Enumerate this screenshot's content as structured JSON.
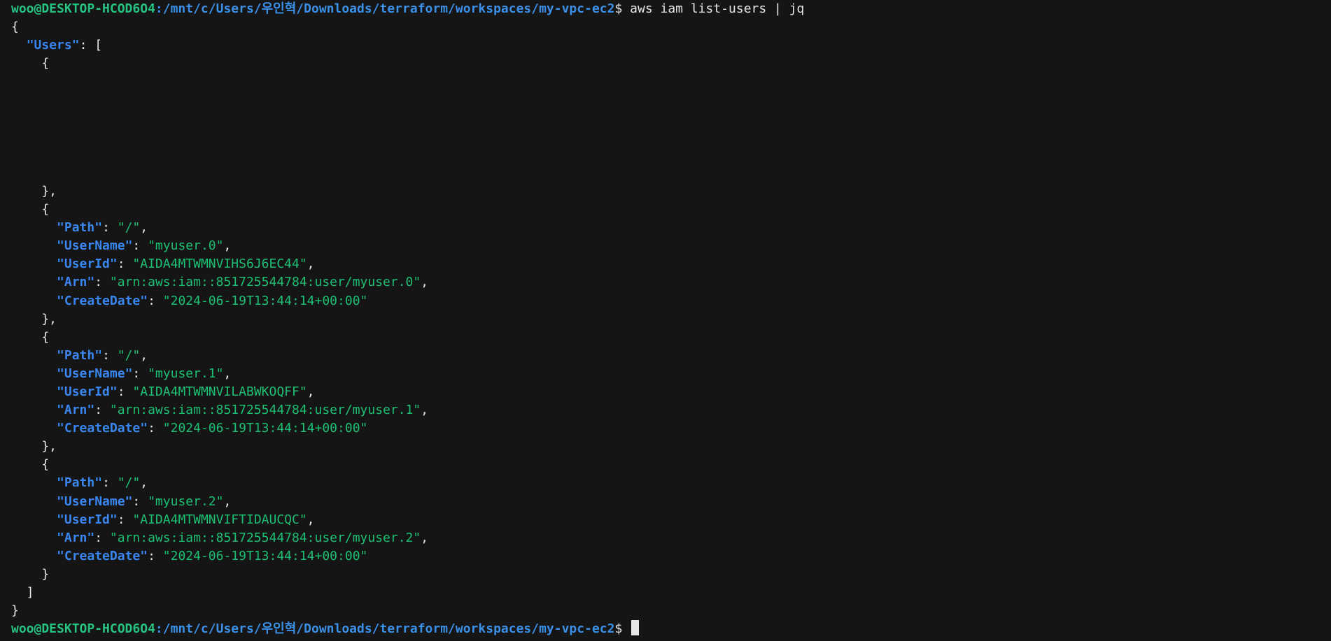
{
  "prompt": {
    "user_host": "woo@DESKTOP-HCOD6O4",
    "path": ":/mnt/c/Users/우인혁/Downloads/terraform/workspaces/my-vpc-ec2",
    "symbol": "$"
  },
  "command": "aws iam list-users | jq",
  "output": {
    "root_key": "Users",
    "users": [
      {
        "Path": "/",
        "UserName": "myuser.0",
        "UserId": "AIDA4MTWMNVIHS6J6EC44",
        "Arn": "arn:aws:iam::851725544784:user/myuser.0",
        "CreateDate": "2024-06-19T13:44:14+00:00"
      },
      {
        "Path": "/",
        "UserName": "myuser.1",
        "UserId": "AIDA4MTWMNVILABWKOQFF",
        "Arn": "arn:aws:iam::851725544784:user/myuser.1",
        "CreateDate": "2024-06-19T13:44:14+00:00"
      },
      {
        "Path": "/",
        "UserName": "myuser.2",
        "UserId": "AIDA4MTWMNVIFTIDAUCQC",
        "Arn": "arn:aws:iam::851725544784:user/myuser.2",
        "CreateDate": "2024-06-19T13:44:14+00:00"
      }
    ]
  },
  "colors": {
    "background": "#151515",
    "prompt_green": "#26c281",
    "prompt_blue": "#3b8fe6",
    "json_key": "#3a86f0",
    "json_string": "#1dbf73",
    "text": "#e8e8e8"
  }
}
